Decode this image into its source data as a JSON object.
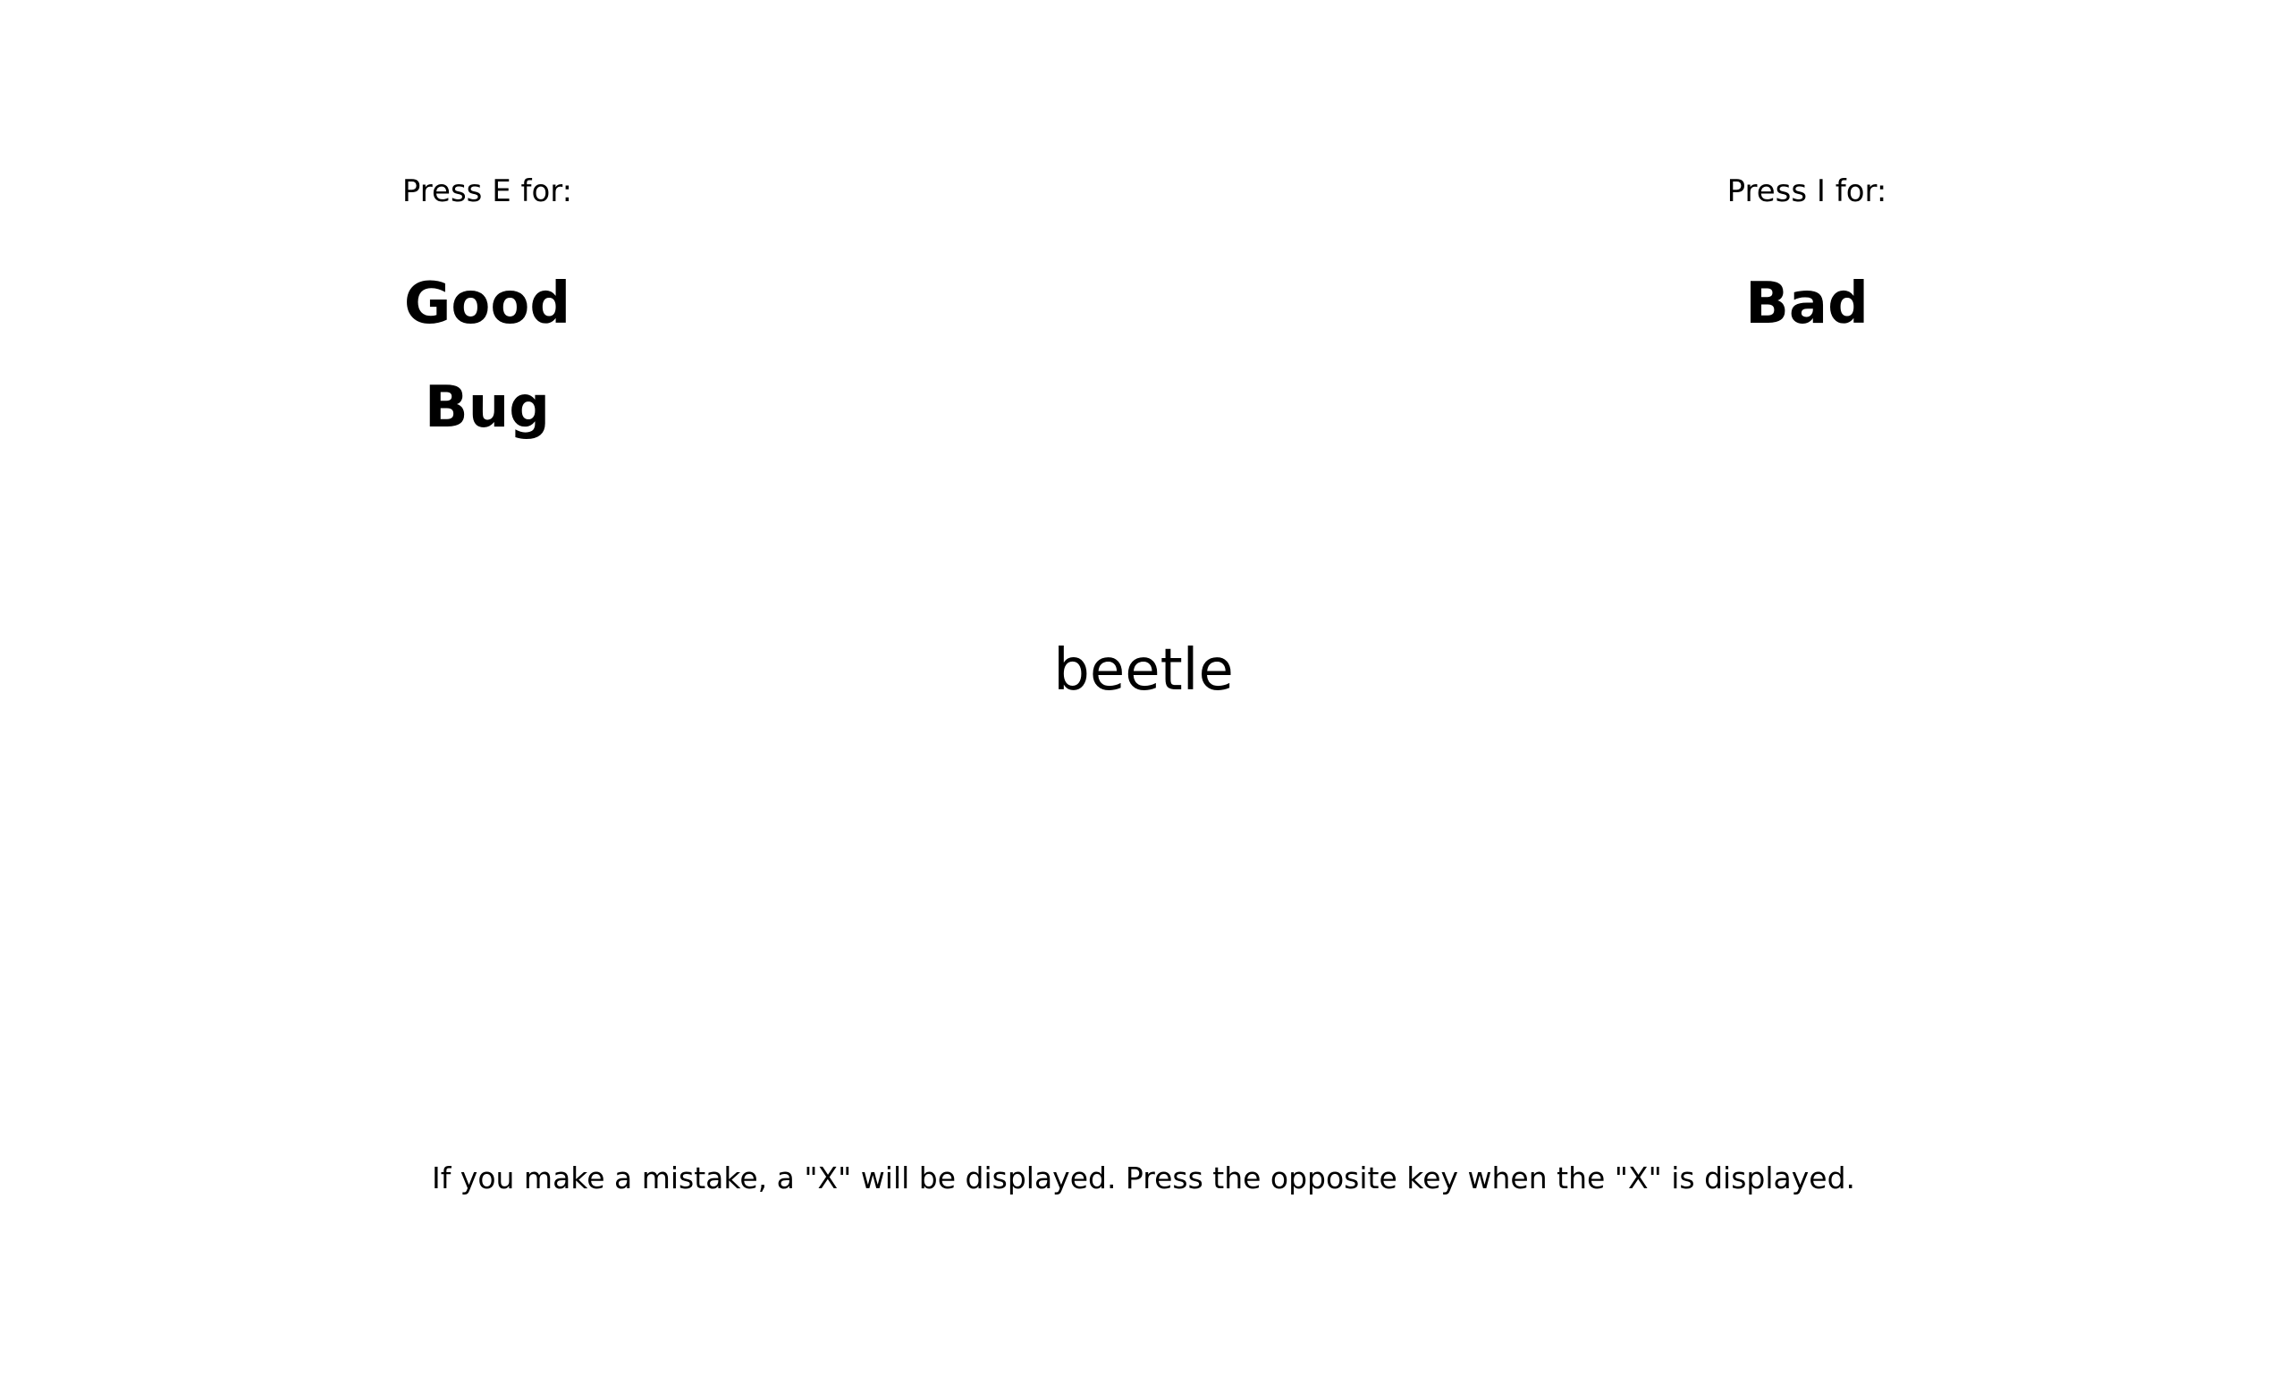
{
  "left": {
    "press_label": "Press E for:",
    "categories": [
      "Good",
      "Bug"
    ]
  },
  "right": {
    "press_label": "Press I for:",
    "categories": [
      "Bad"
    ]
  },
  "stimulus": "beetle",
  "instructions": "If you make a mistake, a \"X\" will be displayed. Press the opposite key when the \"X\" is displayed."
}
